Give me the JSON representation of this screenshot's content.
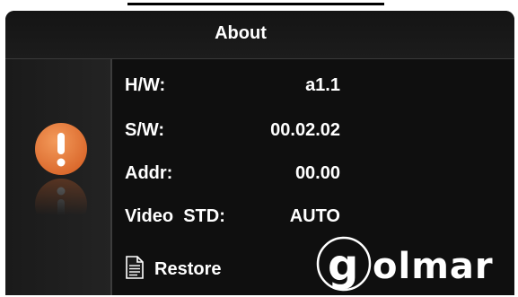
{
  "header": {
    "title": "About"
  },
  "info": {
    "hw": {
      "label": "H/W:",
      "value": "a1.1"
    },
    "sw": {
      "label": "S/W:",
      "value": "00.02.02"
    },
    "addr": {
      "label": "Addr:",
      "value": "00.00"
    },
    "video": {
      "label": "Video  STD:",
      "value": "AUTO"
    }
  },
  "actions": {
    "restore_label": "Restore"
  },
  "branding": {
    "logo_text": "golmar"
  },
  "icons": {
    "alert": "exclamation-circle-icon",
    "restore": "document-icon"
  },
  "colors": {
    "background": "#121212",
    "text": "#ffffff",
    "alert": "#e97a35"
  }
}
